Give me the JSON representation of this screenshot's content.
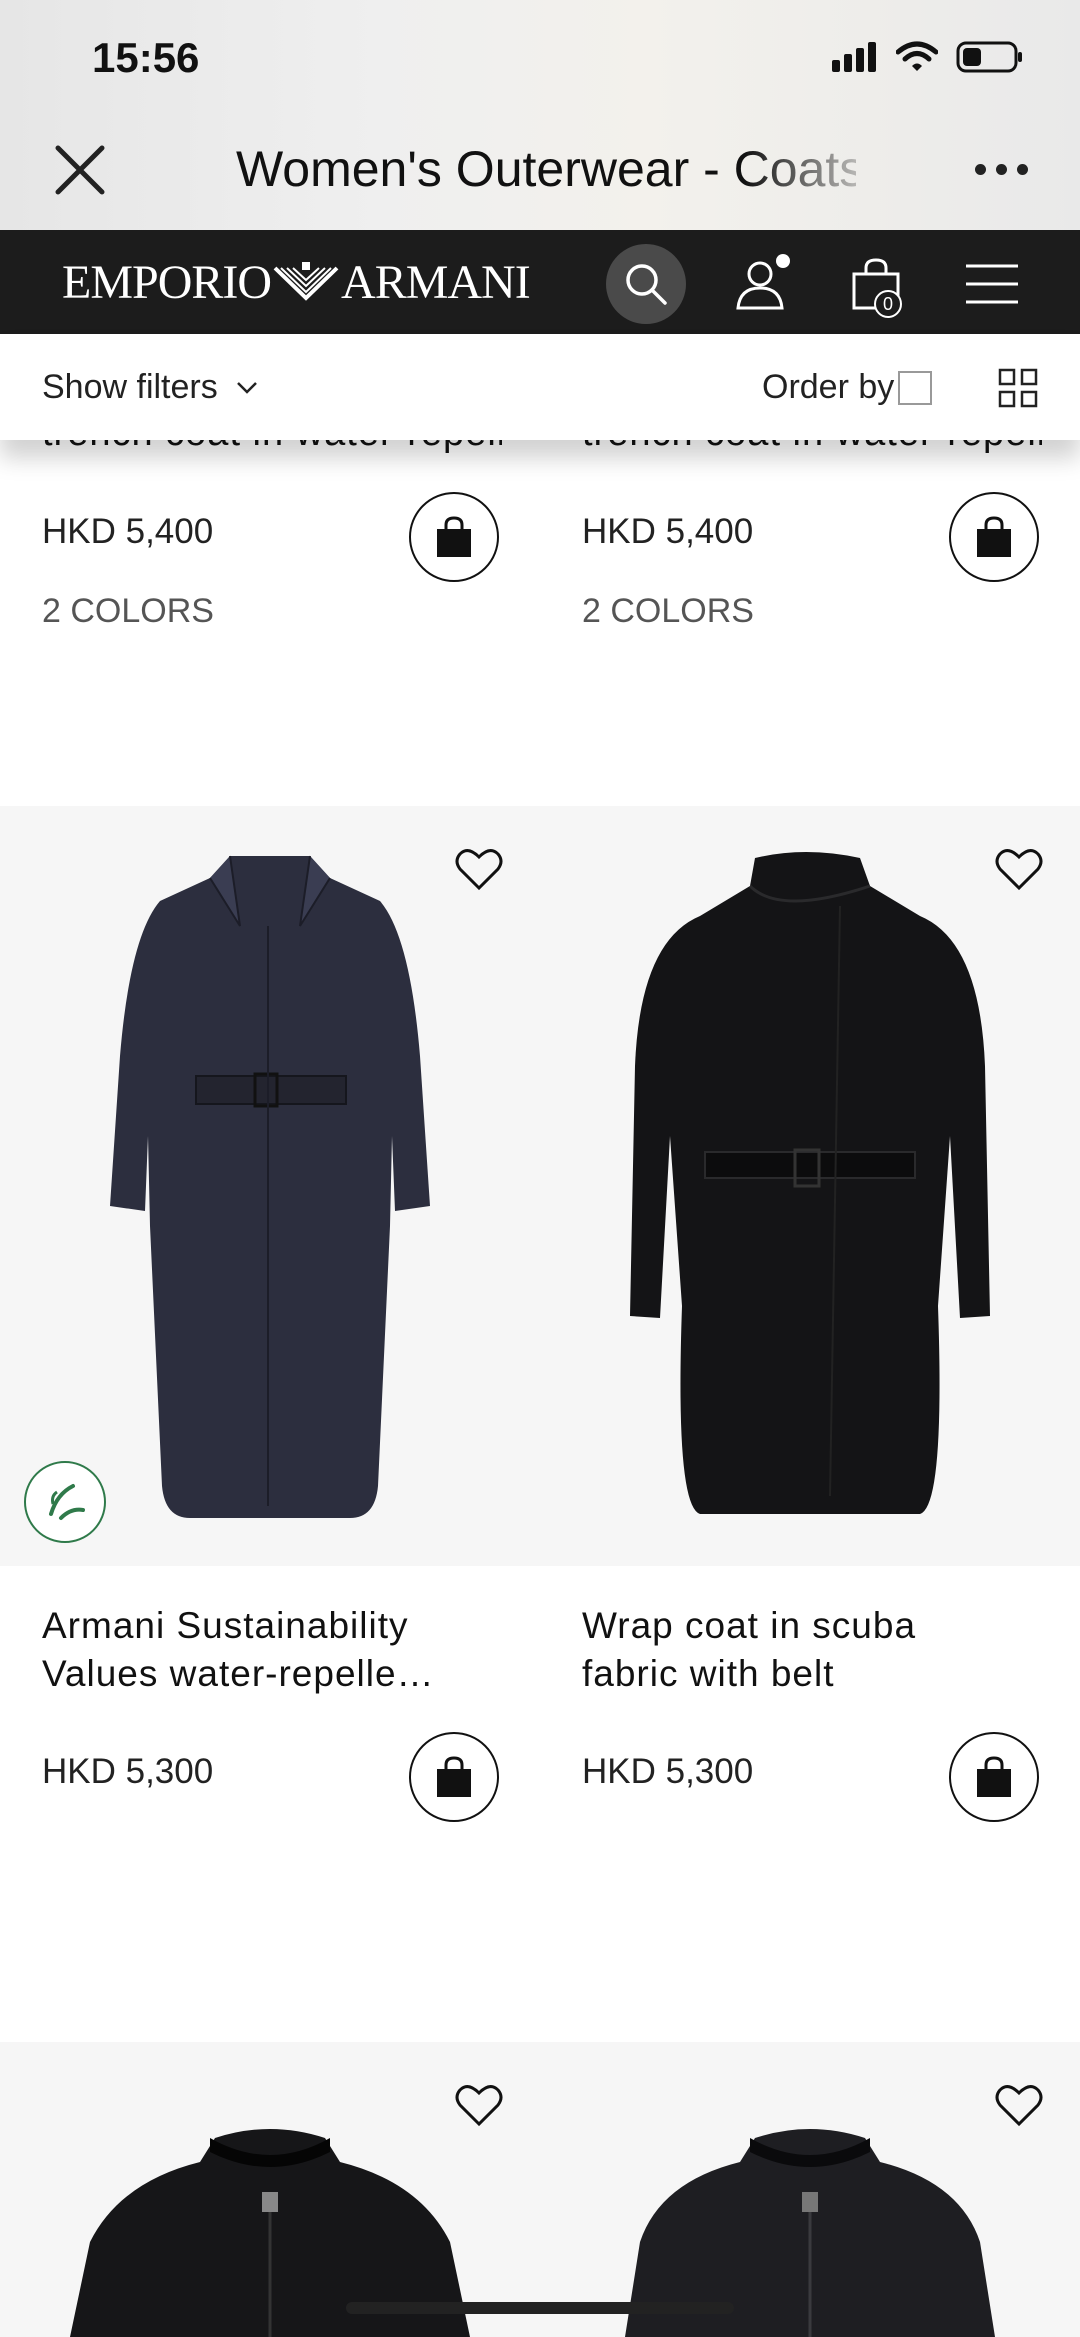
{
  "status_bar": {
    "time": "15:56"
  },
  "webview": {
    "title": "Women's Outerwear - Coats"
  },
  "brand": {
    "logo_left": "EMPORIO",
    "logo_right": "ARMANI",
    "bag_count": "0"
  },
  "filters": {
    "show_filters_label": "Show filters",
    "order_by_label": "Order by"
  },
  "products_top": [
    {
      "name": "trench coat in water-repellent",
      "price": "HKD 5,400",
      "colors": "2 COLORS"
    },
    {
      "name": "trench coat in water-repellent",
      "price": "HKD 5,400",
      "colors": "2 COLORS"
    }
  ],
  "products_middle": [
    {
      "name_line1": "Armani Sustainability",
      "name_line2": "Values water-repelle…",
      "price": "HKD 5,300",
      "image": "navy-belted-long-coat",
      "badge": "sustainability-leaf-icon"
    },
    {
      "name_line1": "Wrap coat in scuba",
      "name_line2": "fabric with belt",
      "price": "HKD 5,300",
      "image": "black-wrap-belted-coat"
    }
  ],
  "products_bottom": [
    {
      "image": "black-puffer-jacket"
    },
    {
      "image": "black-quilted-jacket"
    }
  ],
  "colors": {
    "brand_bar": "#1c1c1c",
    "tile_bg": "#f6f6f6",
    "eco_green": "#2f7a4a"
  }
}
